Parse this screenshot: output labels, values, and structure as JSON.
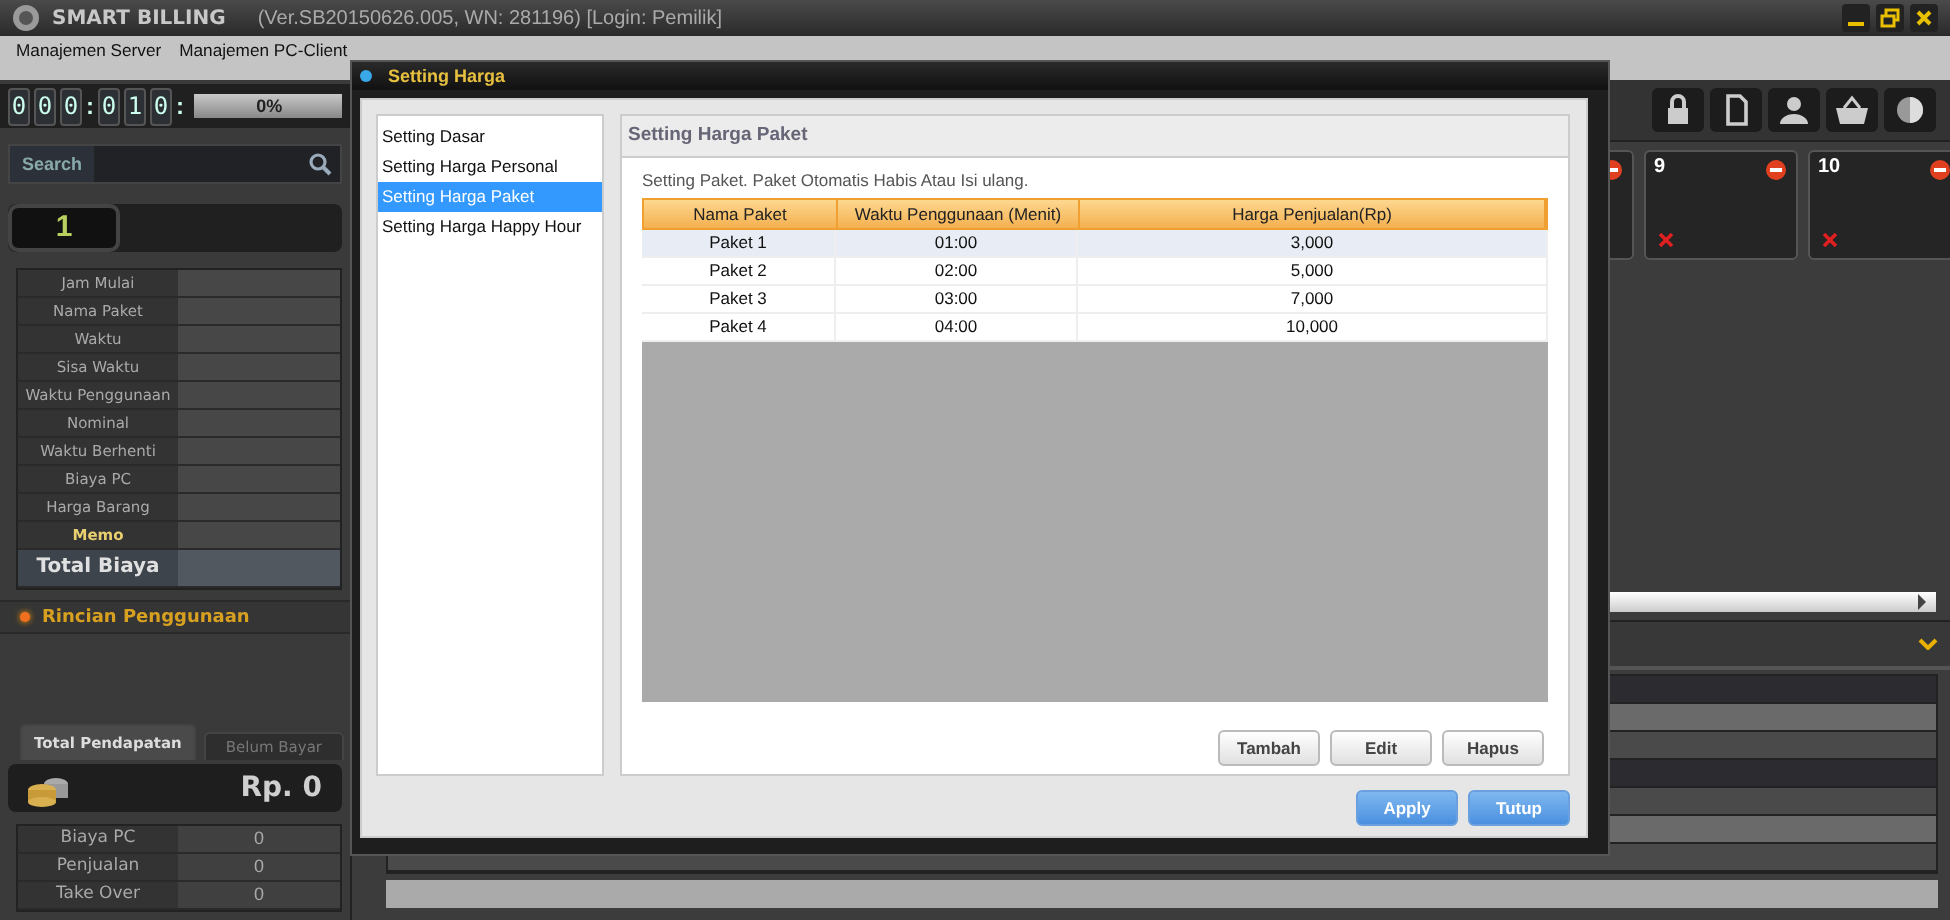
{
  "app": {
    "name": "SMART BILLING",
    "version": "(Ver.SB20150626.005, WN: 281196) [Login: Pemilik]"
  },
  "menu": [
    "Manajemen Server",
    "Manajemen PC-Client"
  ],
  "timer": {
    "cells": [
      {
        "kind": "digit",
        "text": "0"
      },
      {
        "kind": "digit",
        "text": "0"
      },
      {
        "kind": "digit",
        "text": "0"
      },
      {
        "kind": "colon",
        "text": ":"
      },
      {
        "kind": "digit",
        "text": "0"
      },
      {
        "kind": "digit",
        "text": "1"
      },
      {
        "kind": "digit",
        "text": "0"
      },
      {
        "kind": "colon",
        "text": ":"
      }
    ],
    "progress": {
      "level": 0,
      "label": "0%"
    }
  },
  "search": {
    "label": "Search"
  },
  "pc_number": "1",
  "info_rows": [
    {
      "label": "Jam Mulai",
      "kind": "normal"
    },
    {
      "label": "Nama Paket",
      "kind": "normal"
    },
    {
      "label": "Waktu",
      "kind": "normal"
    },
    {
      "label": "Sisa Waktu",
      "kind": "normal"
    },
    {
      "label": "Waktu Penggunaan",
      "kind": "normal"
    },
    {
      "label": "Nominal",
      "kind": "normal"
    },
    {
      "label": "Waktu Berhenti",
      "kind": "normal"
    },
    {
      "label": "Biaya PC",
      "kind": "normal"
    },
    {
      "label": "Harga Barang",
      "kind": "normal"
    },
    {
      "label": "Memo",
      "kind": "memo"
    },
    {
      "label": "Total Biaya",
      "kind": "total"
    }
  ],
  "usage_details": {
    "title": "Rincian Penggunaan"
  },
  "income_tabs": [
    {
      "label": "Total Pendapatan",
      "selected": true
    },
    {
      "label": "Belum Bayar",
      "selected": false
    }
  ],
  "income_total": "Rp. 0",
  "income_rows": [
    {
      "label": "Biaya PC",
      "value": "0"
    },
    {
      "label": "Penjualan",
      "value": "0"
    },
    {
      "label": "Take Over",
      "value": "0"
    }
  ],
  "pc_tiles": [
    {
      "kind": "partial",
      "offline": true
    },
    {
      "kind": "full",
      "label": "9",
      "offline": true
    },
    {
      "kind": "full",
      "label": "10",
      "offline": true
    }
  ],
  "dialog": {
    "title": "Setting Harga",
    "nav": [
      {
        "label": "Setting Dasar",
        "selected": false
      },
      {
        "label": "Setting Harga Personal",
        "selected": false
      },
      {
        "label": "Setting Harga Paket",
        "selected": true
      },
      {
        "label": "Setting Harga Happy Hour",
        "selected": false
      }
    ],
    "panel_title": "Setting Harga Paket",
    "description": "Setting Paket. Paket Otomatis Habis Atau Isi ulang.",
    "table": {
      "columns": [
        "Nama Paket",
        "Waktu Penggunaan (Menit)",
        "Harga Penjualan(Rp)"
      ],
      "rows": [
        {
          "cells": [
            "Paket 1",
            "01:00",
            "3,000"
          ],
          "selected": true
        },
        {
          "cells": [
            "Paket 2",
            "02:00",
            "5,000"
          ],
          "selected": false
        },
        {
          "cells": [
            "Paket 3",
            "03:00",
            "7,000"
          ],
          "selected": false
        },
        {
          "cells": [
            "Paket 4",
            "04:00",
            "10,000"
          ],
          "selected": false
        }
      ]
    },
    "table_buttons": [
      "Tambah",
      "Edit",
      "Hapus"
    ],
    "footer_buttons": [
      "Apply",
      "Tutup"
    ]
  }
}
